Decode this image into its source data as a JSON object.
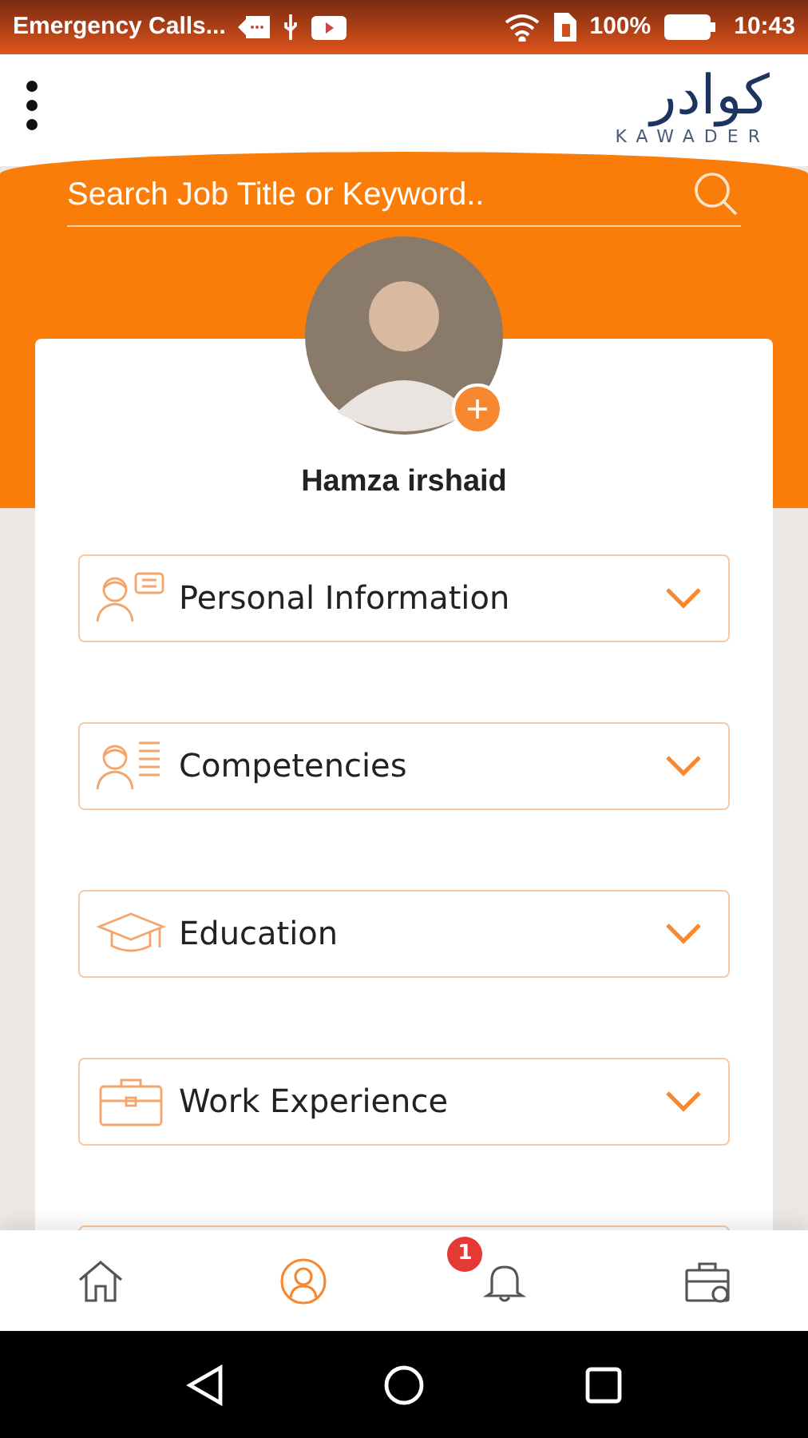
{
  "status_bar": {
    "carrier": "Emergency Calls...",
    "battery": "100%",
    "time": "10:43"
  },
  "header": {
    "logo_arabic": "كوادر",
    "logo_latin": "KAWADER"
  },
  "search": {
    "placeholder": "Search Job Title or Keyword.."
  },
  "profile": {
    "name": "Hamza irshaid"
  },
  "sections": [
    {
      "kind": "personal",
      "label": "Personal Information",
      "expanded": false
    },
    {
      "kind": "competencies",
      "label": "Competencies",
      "expanded": false
    },
    {
      "kind": "education",
      "label": "Education",
      "expanded": false
    },
    {
      "kind": "work",
      "label": "Work Experience",
      "expanded": false
    }
  ],
  "bottom_nav": [
    {
      "kind": "home",
      "selected": false
    },
    {
      "kind": "profile",
      "selected": true
    },
    {
      "kind": "notifications",
      "selected": false,
      "badge": "1"
    },
    {
      "kind": "jobs",
      "selected": false
    }
  ]
}
